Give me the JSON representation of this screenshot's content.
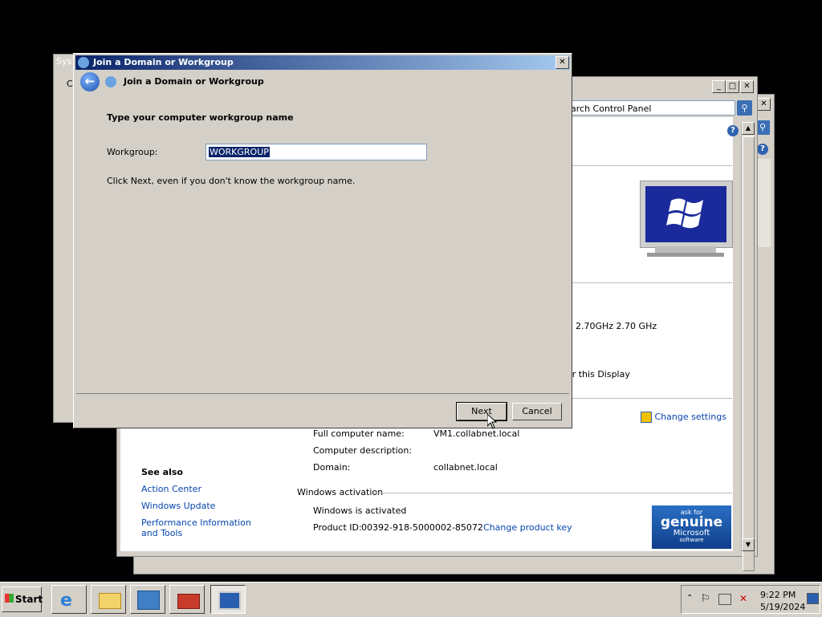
{
  "system_properties_back": {
    "title_partial": "Sys",
    "content_partial": "C"
  },
  "control_panel": {
    "search_placeholder": "arch Control Panel",
    "processor_speed": "2.70GHz   2.70 GHz",
    "display_text": "or this Display",
    "change_settings": "Change settings",
    "full_computer_name_label": "Full computer name:",
    "full_computer_name_value": "VM1.collabnet.local",
    "computer_description_label": "Computer description:",
    "domain_label": "Domain:",
    "domain_value": "collabnet.local",
    "see_also_heading": "See also",
    "see_also_links": [
      "Action Center",
      "Windows Update",
      "Performance Information and Tools"
    ],
    "activation_heading": "Windows activation",
    "activation_status": "Windows is activated",
    "product_id_label": "Product ID:",
    "product_id_value": "00392-918-5000002-85072",
    "change_product_key": "Change product key",
    "genuine_badge": {
      "line1": "ask for",
      "line2": "genuine",
      "line3": "Microsoft",
      "line4": "software"
    }
  },
  "dialog": {
    "title": "Join a Domain or Workgroup",
    "header_title": "Join a Domain or Workgroup",
    "heading": "Type your computer workgroup name",
    "workgroup_label": "Workgroup:",
    "workgroup_value": "WORKGROUP",
    "hint": "Click Next, even if you don't know the workgroup name.",
    "next_label": "Next",
    "cancel_label": "Cancel",
    "close_glyph": "✕"
  },
  "taskbar": {
    "start_label": "Start",
    "apps": [
      "internet-explorer",
      "file-explorer",
      "server-manager",
      "toolbox",
      "remote-desktop"
    ],
    "clock_time": "9:22 PM",
    "clock_date": "5/19/2024"
  },
  "colors": {
    "title_start": "#0a246a",
    "title_end": "#a6caf0",
    "selection": "#0a246a",
    "link": "#0645ad"
  }
}
